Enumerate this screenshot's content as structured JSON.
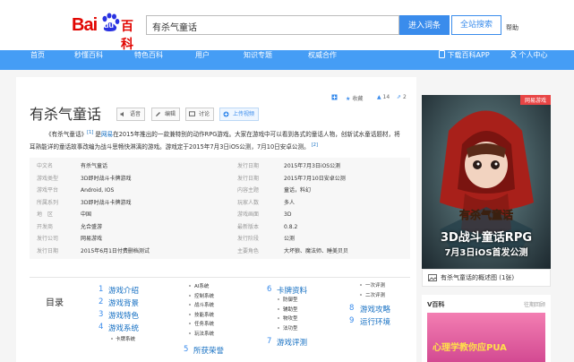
{
  "header": {
    "logo_bai": "Bai",
    "logo_du": "du",
    "logo_baike": "百科",
    "search_value": "有杀气童话",
    "enter_button": "进入词条",
    "site_search_button": "全站搜索",
    "help": "帮助"
  },
  "nav": {
    "items": [
      "首页",
      "秒懂百科",
      "特色百科",
      "用户",
      "知识专题",
      "权威合作"
    ],
    "download": "下载百科APP",
    "user_center": "个人中心"
  },
  "article": {
    "title": "有杀气童话",
    "tools": [
      "语音",
      "编辑",
      "讨论",
      "上传视频"
    ],
    "stats": {
      "collect": "收藏",
      "likes": "14",
      "shares": "2"
    },
    "intro_quote": "《有杀气童话》",
    "intro_ref1": "[1]",
    "intro_is": "是",
    "intro_link": "网易",
    "intro_text": "在2015年推出的一款兼特别的动作RPG游戏。大家在游戏中可以看到各式的童话人物，创新试水童话题材，将耳熟能详的童话故事改编为战斗思畅快淋漓的游戏。游戏定于2015年7月3日iOS公测，7月10日安卓公测。",
    "intro_ref2": "[2]"
  },
  "info_left": [
    {
      "label": "中文名",
      "value": "有杀气童话"
    },
    {
      "label": "游戏类型",
      "value": "3D即时战斗卡牌游戏"
    },
    {
      "label": "游戏平台",
      "value": "Android, IOS"
    },
    {
      "label": "所属系列",
      "value": "3D即时战斗卡牌游戏"
    },
    {
      "label": "地　区",
      "value": "中国"
    },
    {
      "label": "开发商",
      "value": "允合盛游"
    },
    {
      "label": "发行公司",
      "value": "网易游戏"
    },
    {
      "label": "发行日期",
      "value": "2015年6月1日付费删档测试"
    }
  ],
  "info_right": [
    {
      "label": "发行日期",
      "value": "2015年7月3日iOS公测"
    },
    {
      "label": "发行日期",
      "value": "2015年7月10日安卓公测"
    },
    {
      "label": "内容主题",
      "value": "童话，料幻"
    },
    {
      "label": "玩家人数",
      "value": "多人"
    },
    {
      "label": "游戏画面",
      "value": "3D"
    },
    {
      "label": "最新版本",
      "value": "0.8.2"
    },
    {
      "label": "发行阶段",
      "value": "公测"
    },
    {
      "label": "主要角色",
      "value": "大坏狼、魔法师、睡美贝贝"
    }
  ],
  "toc": {
    "title": "目录",
    "col1": [
      {
        "num": "1",
        "label": "游戏介绍"
      },
      {
        "num": "2",
        "label": "游戏背景"
      },
      {
        "num": "3",
        "label": "游戏特色"
      },
      {
        "num": "4",
        "label": "游戏系统"
      }
    ],
    "col1_sub": "卡牌系统",
    "col2_subs": [
      "AI系统",
      "控制系统",
      "战斗系统",
      "技能系统",
      "任务系统",
      "玩法系统"
    ],
    "col2_item": {
      "num": "5",
      "label": "所获荣誉"
    },
    "col3": [
      {
        "num": "6",
        "label": "卡牌资料"
      },
      {
        "num": "7",
        "label": "游戏评测"
      }
    ],
    "col3_subs": [
      "防御型",
      "辅助型",
      "物攻型",
      "法功型"
    ],
    "col4_subs": [
      "一次评测",
      "二次评测"
    ],
    "col4": [
      {
        "num": "8",
        "label": "游戏攻略"
      },
      {
        "num": "9",
        "label": "运行环境"
      }
    ]
  },
  "ad": {
    "badge": "网易游戏",
    "title1": "3D战斗童话RPG",
    "title2": "7月3日iOS首发公测",
    "caption": "有杀气童话的概述图 (1张)"
  },
  "vbaike": {
    "title": "V百科",
    "link": "往期回顾",
    "banner_text": "心理学教你应PUA"
  },
  "colors": {
    "nav_bg": "#459df5",
    "accent": "#3a8cec",
    "brand_red": "#e10602"
  }
}
